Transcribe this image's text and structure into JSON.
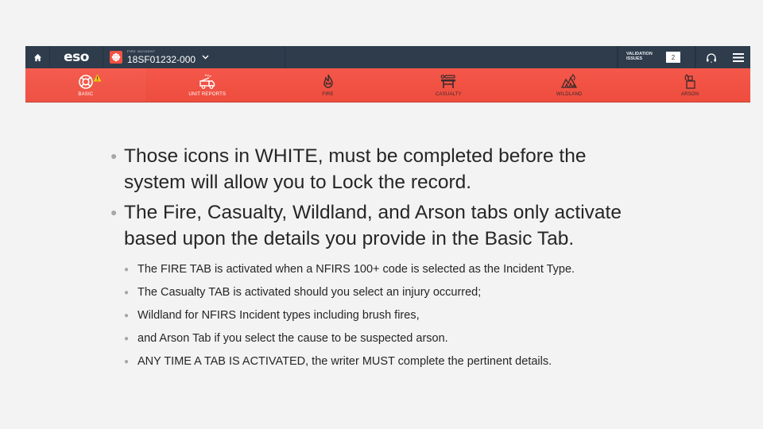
{
  "app": {
    "home_icon": "home-icon",
    "logo": "eso",
    "incident": {
      "kicker": "FIRE INCIDENT",
      "number": "18SF01232-000",
      "badge_icon": "fire-department-emblem-icon",
      "dropdown_icon": "chevron-down-icon"
    },
    "validation": {
      "label": "VALIDATION ISSUES",
      "count": "2"
    },
    "help_icon": "headset-icon",
    "menu_icon": "hamburger-menu-icon",
    "colors": {
      "topbar": "#2e3c4c",
      "tabbar": "#f25241",
      "active_icon": "#ffffff",
      "inactive_icon": "#3b2b2b",
      "warning": "#f5c518"
    },
    "tabs": [
      {
        "label": "BASIC",
        "icon": "life-ring-icon",
        "state": "required",
        "warning": true
      },
      {
        "label": "UNIT REPORTS",
        "icon": "fire-truck-icon",
        "state": "required",
        "warning": false
      },
      {
        "label": "FIRE",
        "icon": "flame-icon",
        "state": "inactive",
        "warning": false
      },
      {
        "label": "CASUALTY",
        "icon": "stretcher-icon",
        "state": "inactive",
        "warning": false
      },
      {
        "label": "WILDLAND",
        "icon": "wildland-fire-icon",
        "state": "inactive",
        "warning": false
      },
      {
        "label": "ARSON",
        "icon": "lighter-icon",
        "state": "inactive",
        "warning": false
      }
    ]
  },
  "slide": {
    "bullets": [
      "Those icons in WHITE, must be completed before the system will allow you to Lock the record.",
      "The Fire, Casualty,  Wildland, and Arson tabs only activate based upon the details you provide in the Basic Tab."
    ],
    "sub_bullets": [
      "The FIRE TAB is activated when a NFIRS 100+ code is selected as the Incident Type.",
      "The Casualty TAB is activated should you select an injury occurred;",
      "Wildland for NFIRS Incident types including brush fires,",
      "and Arson Tab if you select the cause to be suspected arson.",
      "ANY TIME A TAB IS ACTIVATED, the writer MUST complete the pertinent details."
    ]
  }
}
